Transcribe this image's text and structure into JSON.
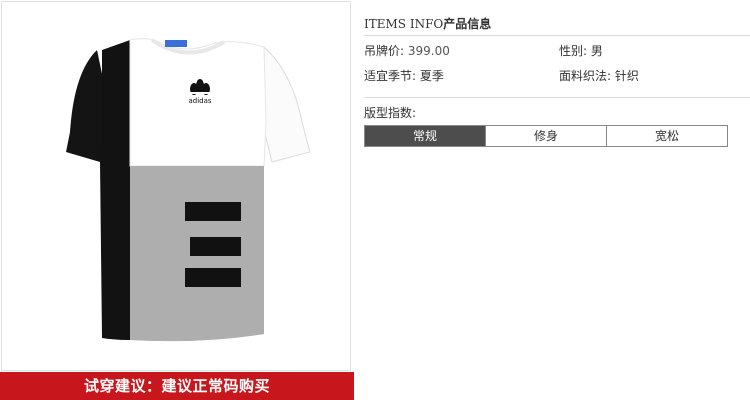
{
  "product": {
    "image_alt": "adidas t-shirt",
    "brand_mark": "adidas"
  },
  "banner": {
    "text": "试穿建议：建议正常码购买"
  },
  "info": {
    "title_en": "ITEMS INFO",
    "title_cn": "产品信息",
    "price_label": "吊牌价:",
    "price_value": "399.00",
    "gender_label": "性别:",
    "gender_value": "男",
    "season_label": "适宜季节:",
    "season_value": "夏季",
    "fabric_label": "面料织法:",
    "fabric_value": "针织",
    "fit_label": "版型指数:",
    "fit_options": [
      "常规",
      "修身",
      "宽松"
    ],
    "fit_selected_index": 0
  },
  "colors": {
    "banner_bg": "#c8161d",
    "active_cell": "#4d4d4d"
  }
}
